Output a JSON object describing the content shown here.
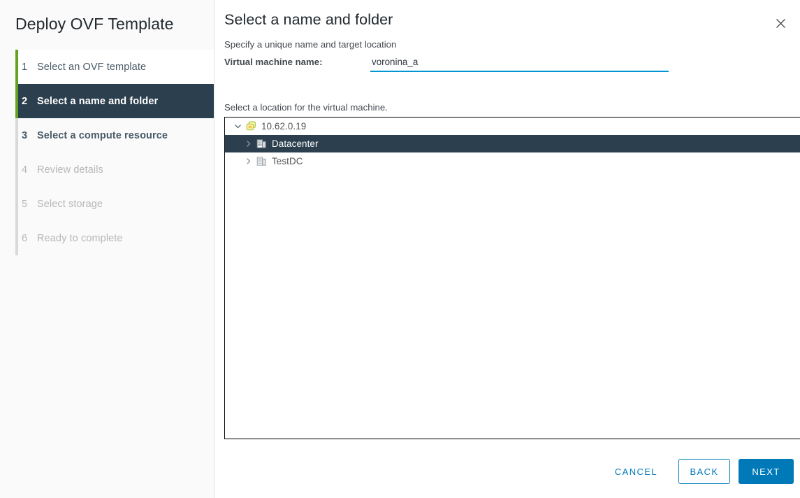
{
  "wizard": {
    "title": "Deploy OVF Template",
    "steps": [
      {
        "num": "1",
        "label": "Select an OVF template",
        "state": "visited"
      },
      {
        "num": "2",
        "label": "Select a name and folder",
        "state": "active"
      },
      {
        "num": "3",
        "label": "Select a compute resource",
        "state": "pending"
      },
      {
        "num": "4",
        "label": "Review details",
        "state": "upcoming"
      },
      {
        "num": "5",
        "label": "Select storage",
        "state": "upcoming"
      },
      {
        "num": "6",
        "label": "Ready to complete",
        "state": "upcoming"
      }
    ]
  },
  "pane": {
    "title": "Select a name and folder",
    "subtitle": "Specify a unique name and target location",
    "close_icon": "close-icon"
  },
  "form": {
    "name_label": "Virtual machine name:",
    "name_value": "voronina_a",
    "name_placeholder": "",
    "location_label": "Select a location for the virtual machine."
  },
  "tree": {
    "nodes": [
      {
        "label": "10.62.0.19",
        "icon": "vcenter-icon",
        "chevron": "chevron-down-icon",
        "expanded": true,
        "selected": false,
        "depth": 0
      },
      {
        "label": "Datacenter",
        "icon": "datacenter-icon",
        "chevron": "chevron-right-icon",
        "expanded": false,
        "selected": true,
        "depth": 1
      },
      {
        "label": "TestDC",
        "icon": "datacenter-icon",
        "chevron": "chevron-right-icon",
        "expanded": false,
        "selected": false,
        "depth": 1
      }
    ]
  },
  "footer": {
    "cancel_label": "CANCEL",
    "back_label": "BACK",
    "next_label": "NEXT"
  },
  "colors": {
    "accent_blue": "#0079b8",
    "underline_blue": "#0095d3",
    "selected_dark": "#2b3f4e",
    "progress_green": "#62a420",
    "sidebar_bg": "#fafafa"
  }
}
